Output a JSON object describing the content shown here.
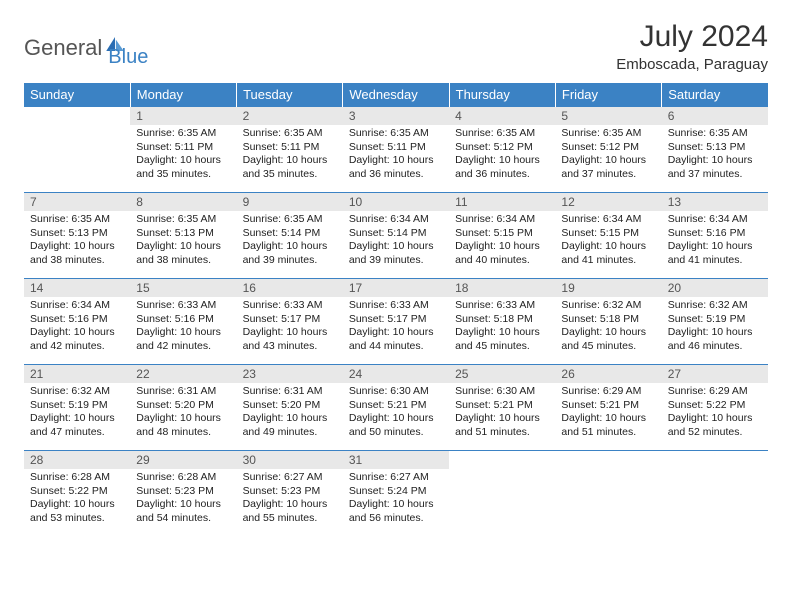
{
  "brand": {
    "part1": "General",
    "part2": "Blue"
  },
  "title": "July 2024",
  "location": "Emboscada, Paraguay",
  "weekdays": [
    "Sunday",
    "Monday",
    "Tuesday",
    "Wednesday",
    "Thursday",
    "Friday",
    "Saturday"
  ],
  "weeks": [
    [
      null,
      {
        "n": "1",
        "sr": "6:35 AM",
        "ss": "5:11 PM",
        "dl": "10 hours and 35 minutes."
      },
      {
        "n": "2",
        "sr": "6:35 AM",
        "ss": "5:11 PM",
        "dl": "10 hours and 35 minutes."
      },
      {
        "n": "3",
        "sr": "6:35 AM",
        "ss": "5:11 PM",
        "dl": "10 hours and 36 minutes."
      },
      {
        "n": "4",
        "sr": "6:35 AM",
        "ss": "5:12 PM",
        "dl": "10 hours and 36 minutes."
      },
      {
        "n": "5",
        "sr": "6:35 AM",
        "ss": "5:12 PM",
        "dl": "10 hours and 37 minutes."
      },
      {
        "n": "6",
        "sr": "6:35 AM",
        "ss": "5:13 PM",
        "dl": "10 hours and 37 minutes."
      }
    ],
    [
      {
        "n": "7",
        "sr": "6:35 AM",
        "ss": "5:13 PM",
        "dl": "10 hours and 38 minutes."
      },
      {
        "n": "8",
        "sr": "6:35 AM",
        "ss": "5:13 PM",
        "dl": "10 hours and 38 minutes."
      },
      {
        "n": "9",
        "sr": "6:35 AM",
        "ss": "5:14 PM",
        "dl": "10 hours and 39 minutes."
      },
      {
        "n": "10",
        "sr": "6:34 AM",
        "ss": "5:14 PM",
        "dl": "10 hours and 39 minutes."
      },
      {
        "n": "11",
        "sr": "6:34 AM",
        "ss": "5:15 PM",
        "dl": "10 hours and 40 minutes."
      },
      {
        "n": "12",
        "sr": "6:34 AM",
        "ss": "5:15 PM",
        "dl": "10 hours and 41 minutes."
      },
      {
        "n": "13",
        "sr": "6:34 AM",
        "ss": "5:16 PM",
        "dl": "10 hours and 41 minutes."
      }
    ],
    [
      {
        "n": "14",
        "sr": "6:34 AM",
        "ss": "5:16 PM",
        "dl": "10 hours and 42 minutes."
      },
      {
        "n": "15",
        "sr": "6:33 AM",
        "ss": "5:16 PM",
        "dl": "10 hours and 42 minutes."
      },
      {
        "n": "16",
        "sr": "6:33 AM",
        "ss": "5:17 PM",
        "dl": "10 hours and 43 minutes."
      },
      {
        "n": "17",
        "sr": "6:33 AM",
        "ss": "5:17 PM",
        "dl": "10 hours and 44 minutes."
      },
      {
        "n": "18",
        "sr": "6:33 AM",
        "ss": "5:18 PM",
        "dl": "10 hours and 45 minutes."
      },
      {
        "n": "19",
        "sr": "6:32 AM",
        "ss": "5:18 PM",
        "dl": "10 hours and 45 minutes."
      },
      {
        "n": "20",
        "sr": "6:32 AM",
        "ss": "5:19 PM",
        "dl": "10 hours and 46 minutes."
      }
    ],
    [
      {
        "n": "21",
        "sr": "6:32 AM",
        "ss": "5:19 PM",
        "dl": "10 hours and 47 minutes."
      },
      {
        "n": "22",
        "sr": "6:31 AM",
        "ss": "5:20 PM",
        "dl": "10 hours and 48 minutes."
      },
      {
        "n": "23",
        "sr": "6:31 AM",
        "ss": "5:20 PM",
        "dl": "10 hours and 49 minutes."
      },
      {
        "n": "24",
        "sr": "6:30 AM",
        "ss": "5:21 PM",
        "dl": "10 hours and 50 minutes."
      },
      {
        "n": "25",
        "sr": "6:30 AM",
        "ss": "5:21 PM",
        "dl": "10 hours and 51 minutes."
      },
      {
        "n": "26",
        "sr": "6:29 AM",
        "ss": "5:21 PM",
        "dl": "10 hours and 51 minutes."
      },
      {
        "n": "27",
        "sr": "6:29 AM",
        "ss": "5:22 PM",
        "dl": "10 hours and 52 minutes."
      }
    ],
    [
      {
        "n": "28",
        "sr": "6:28 AM",
        "ss": "5:22 PM",
        "dl": "10 hours and 53 minutes."
      },
      {
        "n": "29",
        "sr": "6:28 AM",
        "ss": "5:23 PM",
        "dl": "10 hours and 54 minutes."
      },
      {
        "n": "30",
        "sr": "6:27 AM",
        "ss": "5:23 PM",
        "dl": "10 hours and 55 minutes."
      },
      {
        "n": "31",
        "sr": "6:27 AM",
        "ss": "5:24 PM",
        "dl": "10 hours and 56 minutes."
      },
      null,
      null,
      null
    ]
  ],
  "labels": {
    "sunrise": "Sunrise:",
    "sunset": "Sunset:",
    "daylight": "Daylight:"
  }
}
